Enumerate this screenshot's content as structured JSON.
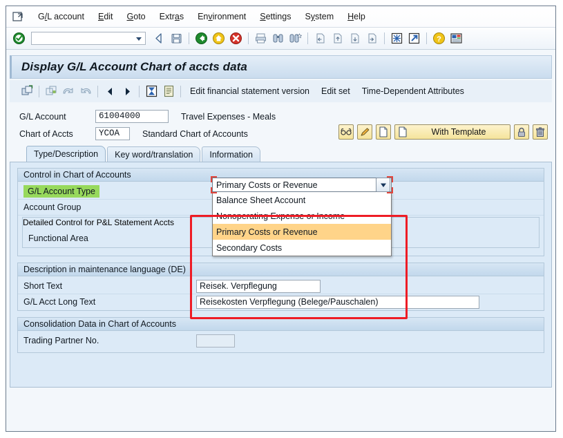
{
  "menu": {
    "system_icon": "system-menu-icon",
    "items": [
      {
        "pre": "G",
        "key": "/",
        "post": "L account"
      },
      {
        "pre": "",
        "key": "E",
        "post": "dit"
      },
      {
        "pre": "",
        "key": "G",
        "post": "oto"
      },
      {
        "pre": "Extr",
        "key": "a",
        "post": "s"
      },
      {
        "pre": "En",
        "key": "v",
        "post": "ironment"
      },
      {
        "pre": "",
        "key": "S",
        "post": "ettings"
      },
      {
        "pre": "S",
        "key": "y",
        "post": "stem"
      },
      {
        "pre": "",
        "key": "H",
        "post": "elp"
      }
    ]
  },
  "toolbar": {
    "command_value": "",
    "command_placeholder": "",
    "icons": [
      "enter-checkmark-icon",
      "back-arrow-icon",
      "save-icon",
      "exit-icon",
      "home-icon",
      "cancel-icon",
      "print-icon",
      "find-icon",
      "find-next-icon",
      "first-page-icon",
      "previous-page-icon",
      "next-page-icon",
      "last-page-icon",
      "new-session-icon",
      "create-shortcut-icon",
      "help-icon",
      "customize-local-layout-icon"
    ]
  },
  "title": "Display G/L Account Chart of accts data",
  "app_toolbar": {
    "icons": [
      "display-change-icon",
      "other-gl-account-icon",
      "undo-icon",
      "redo-icon",
      "previous-account-icon",
      "next-account-icon",
      "check-icon",
      "notes-icon"
    ],
    "buttons": [
      "Edit financial statement version",
      "Edit set",
      "Time-Dependent Attributes"
    ]
  },
  "header": {
    "gl_account_label": "G/L Account",
    "gl_account_value": "61004000",
    "gl_account_desc": "Travel Expenses - Meals",
    "chart_label": "Chart of Accts",
    "chart_value": "YCOA",
    "chart_desc": "Standard Chart of Accounts",
    "buttons": [
      {
        "name": "edit-set-icon-button",
        "label": "",
        "icon": "glasses-icon"
      },
      {
        "name": "change-button",
        "label": "",
        "icon": "pencil-icon"
      },
      {
        "name": "create-button",
        "label": "",
        "icon": "page-icon"
      },
      {
        "name": "with-template-button",
        "label": "With Template",
        "icon": "page-icon"
      },
      {
        "name": "block-button",
        "label": "",
        "icon": "lock-icon"
      },
      {
        "name": "delete-button",
        "label": "",
        "icon": "trash-icon"
      }
    ]
  },
  "tabs": [
    {
      "label": "Type/Description",
      "active": true
    },
    {
      "label": "Key word/translation",
      "active": false
    },
    {
      "label": "Information",
      "active": false
    }
  ],
  "control_group": {
    "heading": "Control in Chart of Accounts",
    "gl_account_type_label": "G/L Account Type",
    "account_group_label": "Account Group",
    "detailed_control_heading": "Detailed Control for P&L Statement Accts",
    "functional_area_label": "Functional Area"
  },
  "dropdown": {
    "name": "gl-account-type-dropdown",
    "selected": "Primary Costs or Revenue",
    "arrow_icon": "chevron-down-icon",
    "options": [
      {
        "label": "Balance Sheet Account",
        "selected": false
      },
      {
        "label": "Nonoperating Expense or Income",
        "selected": false
      },
      {
        "label": "Primary Costs or Revenue",
        "selected": true
      },
      {
        "label": "Secondary Costs",
        "selected": false
      }
    ]
  },
  "description_group": {
    "heading": "Description in maintenance language (DE)",
    "short_text_label": "Short Text",
    "short_text_value": "Reisek. Verpflegung",
    "long_text_label": "G/L Acct Long Text",
    "long_text_value": "Reisekosten Verpflegung (Belege/Pauschalen)"
  },
  "consolidation_group": {
    "heading": "Consolidation Data in Chart of Accounts",
    "trading_partner_label": "Trading Partner No.",
    "trading_partner_value": ""
  },
  "colors": {
    "highlight_green": "#97d95c",
    "dropdown_selected": "#ffd489",
    "annotation_red": "#ee1c25",
    "button_yellow": "#f5e49b",
    "panel_blue": "#dceaf7"
  }
}
